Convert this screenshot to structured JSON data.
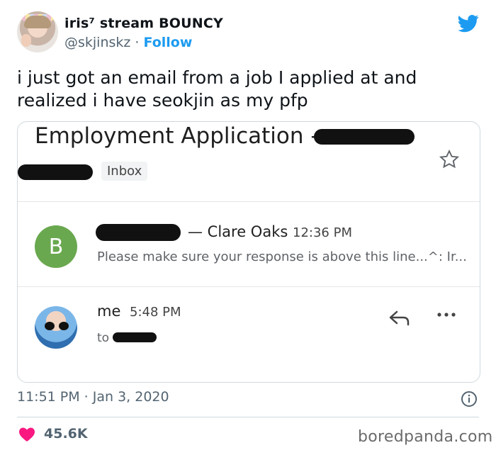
{
  "tweet": {
    "display_name": "iris⁷ stream BOUNCY",
    "handle": "@skjinskz",
    "separator": " · ",
    "follow_label": "Follow",
    "text": "i just got an email from a job I applied at and realized i have seokjin as my pfp",
    "timestamp": "11:51 PM · Jan 3, 2020",
    "likes": "45.6K"
  },
  "email": {
    "subject": "Employment Application -",
    "inbox_label": "Inbox",
    "thread": [
      {
        "avatar_letter": "B",
        "name": "— Clare Oaks",
        "time": "12:36 PM",
        "snippet": "Please make sure your response is above this line...^: Ir..."
      },
      {
        "name": "me",
        "time": "5:48 PM",
        "to_prefix": "to"
      }
    ]
  },
  "watermark": "boredpanda.com",
  "colors": {
    "twitter_blue": "#1d9bf0",
    "heart": "#f91880",
    "gmail_avatar_green": "#6aa84f"
  },
  "icons": [
    "twitter-logo-icon",
    "star-icon",
    "reply-icon",
    "more-icon",
    "info-icon",
    "heart-icon"
  ]
}
